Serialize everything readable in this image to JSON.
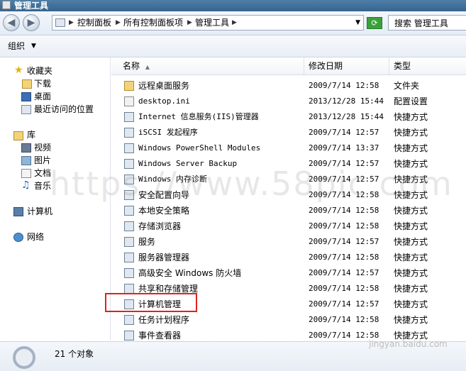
{
  "window": {
    "title": "管理工具"
  },
  "address": {
    "crumbs": [
      "控制面板",
      "所有控制面板项",
      "管理工具"
    ],
    "search_placeholder": "搜索 管理工具"
  },
  "toolbar": {
    "organize_label": "组织"
  },
  "nav": {
    "favorites": {
      "label": "收藏夹",
      "items": [
        "下载",
        "桌面",
        "最近访问的位置"
      ]
    },
    "libraries": {
      "label": "库",
      "items": [
        "视频",
        "图片",
        "文档",
        "音乐"
      ]
    },
    "computer": {
      "label": "计算机"
    },
    "network": {
      "label": "网络"
    }
  },
  "columns": {
    "name": "名称",
    "date": "修改日期",
    "type": "类型"
  },
  "files": [
    {
      "name": "远程桌面服务",
      "date": "2009/7/14 12:58",
      "type": "文件夹",
      "icon": "folder-icon"
    },
    {
      "name": "desktop.ini",
      "date": "2013/12/28 15:44",
      "type": "配置设置",
      "icon": "settings-file-icon"
    },
    {
      "name": "Internet 信息服务(IIS)管理器",
      "date": "2013/12/28 15:44",
      "type": "快捷方式",
      "icon": "shortcut-icon"
    },
    {
      "name": "iSCSI 发起程序",
      "date": "2009/7/14 12:57",
      "type": "快捷方式",
      "icon": "shortcut-icon"
    },
    {
      "name": "Windows PowerShell Modules",
      "date": "2009/7/14 13:37",
      "type": "快捷方式",
      "icon": "shortcut-icon"
    },
    {
      "name": "Windows Server Backup",
      "date": "2009/7/14 12:57",
      "type": "快捷方式",
      "icon": "shortcut-icon"
    },
    {
      "name": "Windows 内存诊断",
      "date": "2009/7/14 12:57",
      "type": "快捷方式",
      "icon": "shortcut-icon"
    },
    {
      "name": "安全配置向导",
      "date": "2009/7/14 12:58",
      "type": "快捷方式",
      "icon": "shortcut-icon"
    },
    {
      "name": "本地安全策略",
      "date": "2009/7/14 12:58",
      "type": "快捷方式",
      "icon": "shortcut-icon"
    },
    {
      "name": "存储浏览器",
      "date": "2009/7/14 12:58",
      "type": "快捷方式",
      "icon": "shortcut-icon"
    },
    {
      "name": "服务",
      "date": "2009/7/14 12:57",
      "type": "快捷方式",
      "icon": "shortcut-icon"
    },
    {
      "name": "服务器管理器",
      "date": "2009/7/14 12:58",
      "type": "快捷方式",
      "icon": "shortcut-icon"
    },
    {
      "name": "高级安全 Windows 防火墙",
      "date": "2009/7/14 12:57",
      "type": "快捷方式",
      "icon": "shortcut-icon"
    },
    {
      "name": "共享和存储管理",
      "date": "2009/7/14 12:58",
      "type": "快捷方式",
      "icon": "shortcut-icon"
    },
    {
      "name": "计算机管理",
      "date": "2009/7/14 12:57",
      "type": "快捷方式",
      "icon": "shortcut-icon"
    },
    {
      "name": "任务计划程序",
      "date": "2009/7/14 12:58",
      "type": "快捷方式",
      "icon": "shortcut-icon"
    },
    {
      "name": "事件查看器",
      "date": "2009/7/14 12:58",
      "type": "快捷方式",
      "icon": "shortcut-icon"
    }
  ],
  "status": {
    "count": "21 个对象"
  },
  "watermark": {
    "text": "https://www.58pic.com",
    "corner": "jingyan.baidu.com"
  },
  "colors": {
    "highlight": "#dd2222",
    "titlebar": "#3d6e99"
  }
}
